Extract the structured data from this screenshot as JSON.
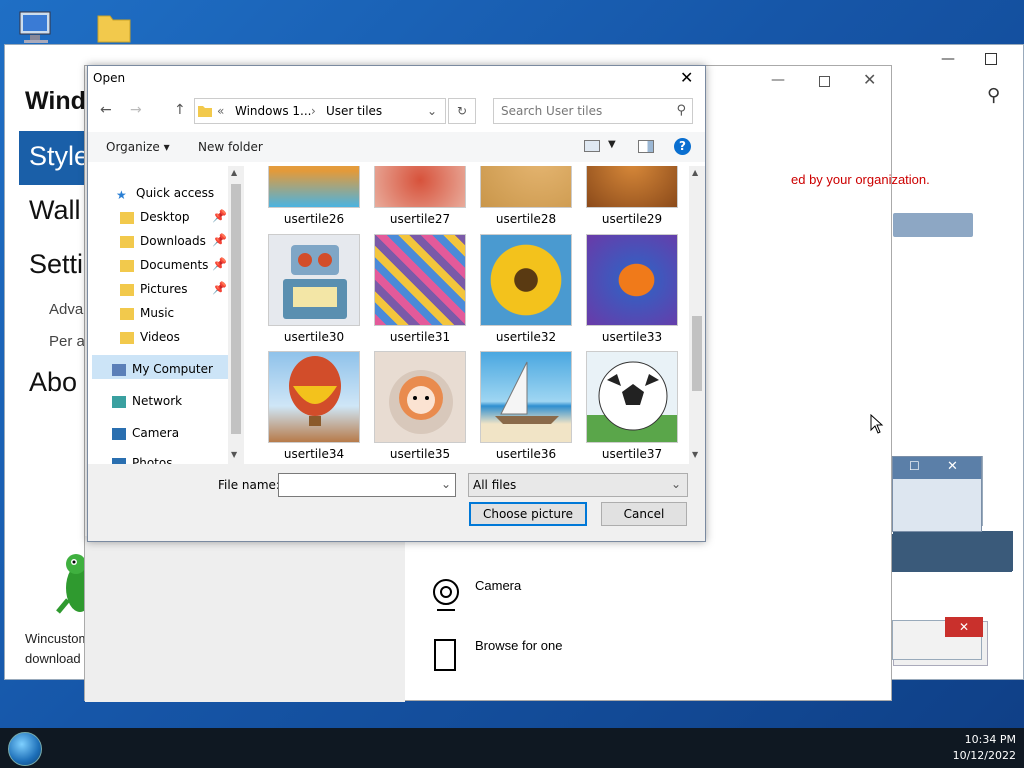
{
  "desktop": {
    "wincustomize_caption_1": "Wincustom",
    "wincustomize_caption_2": "download"
  },
  "settings_window": {
    "title_partial": "Windo",
    "nav": {
      "selected": "Style",
      "item_wall": "Wall",
      "item_setti": "Setti",
      "item_adva": "Adva",
      "item_per": "Per a",
      "item_abo": "Abo"
    }
  },
  "account_window": {
    "warning_text": "ed by your organization.",
    "option_camera": "Camera",
    "option_browse": "Browse for one"
  },
  "dialog": {
    "title": "Open",
    "breadcrumb": [
      "Windows 1...",
      "User tiles"
    ],
    "search_placeholder": "Search User tiles",
    "toolbar": {
      "organize": "Organize",
      "new_folder": "New folder"
    },
    "nav_items": [
      {
        "label": "Quick access",
        "icon": "star-icon"
      },
      {
        "label": "Desktop",
        "icon": "folder-icon",
        "pinned": true
      },
      {
        "label": "Downloads",
        "icon": "folder-icon",
        "pinned": true
      },
      {
        "label": "Documents",
        "icon": "folder-icon",
        "pinned": true
      },
      {
        "label": "Pictures",
        "icon": "folder-icon",
        "pinned": true
      },
      {
        "label": "Music",
        "icon": "folder-icon"
      },
      {
        "label": "Videos",
        "icon": "folder-icon"
      },
      {
        "label": "My Computer",
        "icon": "computer-icon",
        "selected": true
      },
      {
        "label": "Network",
        "icon": "network-icon"
      },
      {
        "label": "Camera",
        "icon": "camera-icon"
      },
      {
        "label": "Photos",
        "icon": "photos-icon"
      }
    ],
    "files": [
      {
        "name": "usertile26",
        "color": "#e39a3a"
      },
      {
        "name": "usertile27",
        "color": "#d7523b"
      },
      {
        "name": "usertile28",
        "color": "#c9964a"
      },
      {
        "name": "usertile29",
        "color": "#b5651d"
      },
      {
        "name": "usertile30",
        "color": "#5a8fb0"
      },
      {
        "name": "usertile31",
        "color": "#7a5aa8"
      },
      {
        "name": "usertile32",
        "color": "#e8b21c"
      },
      {
        "name": "usertile33",
        "color": "#3b5bbf"
      },
      {
        "name": "usertile34",
        "color": "#d24d2a"
      },
      {
        "name": "usertile35",
        "color": "#e98b4e"
      },
      {
        "name": "usertile36",
        "color": "#2f8fd0"
      },
      {
        "name": "usertile37",
        "color": "#444444"
      }
    ],
    "file_name_label": "File name:",
    "file_name_value": "",
    "file_type": "All files",
    "choose_button": "Choose picture",
    "cancel_button": "Cancel"
  },
  "taskbar": {
    "time": "10:34 PM",
    "date": "10/12/2022"
  },
  "colors": {
    "accent": "#0078d7",
    "selection": "#cce4f7",
    "warning": "#cc0000"
  }
}
